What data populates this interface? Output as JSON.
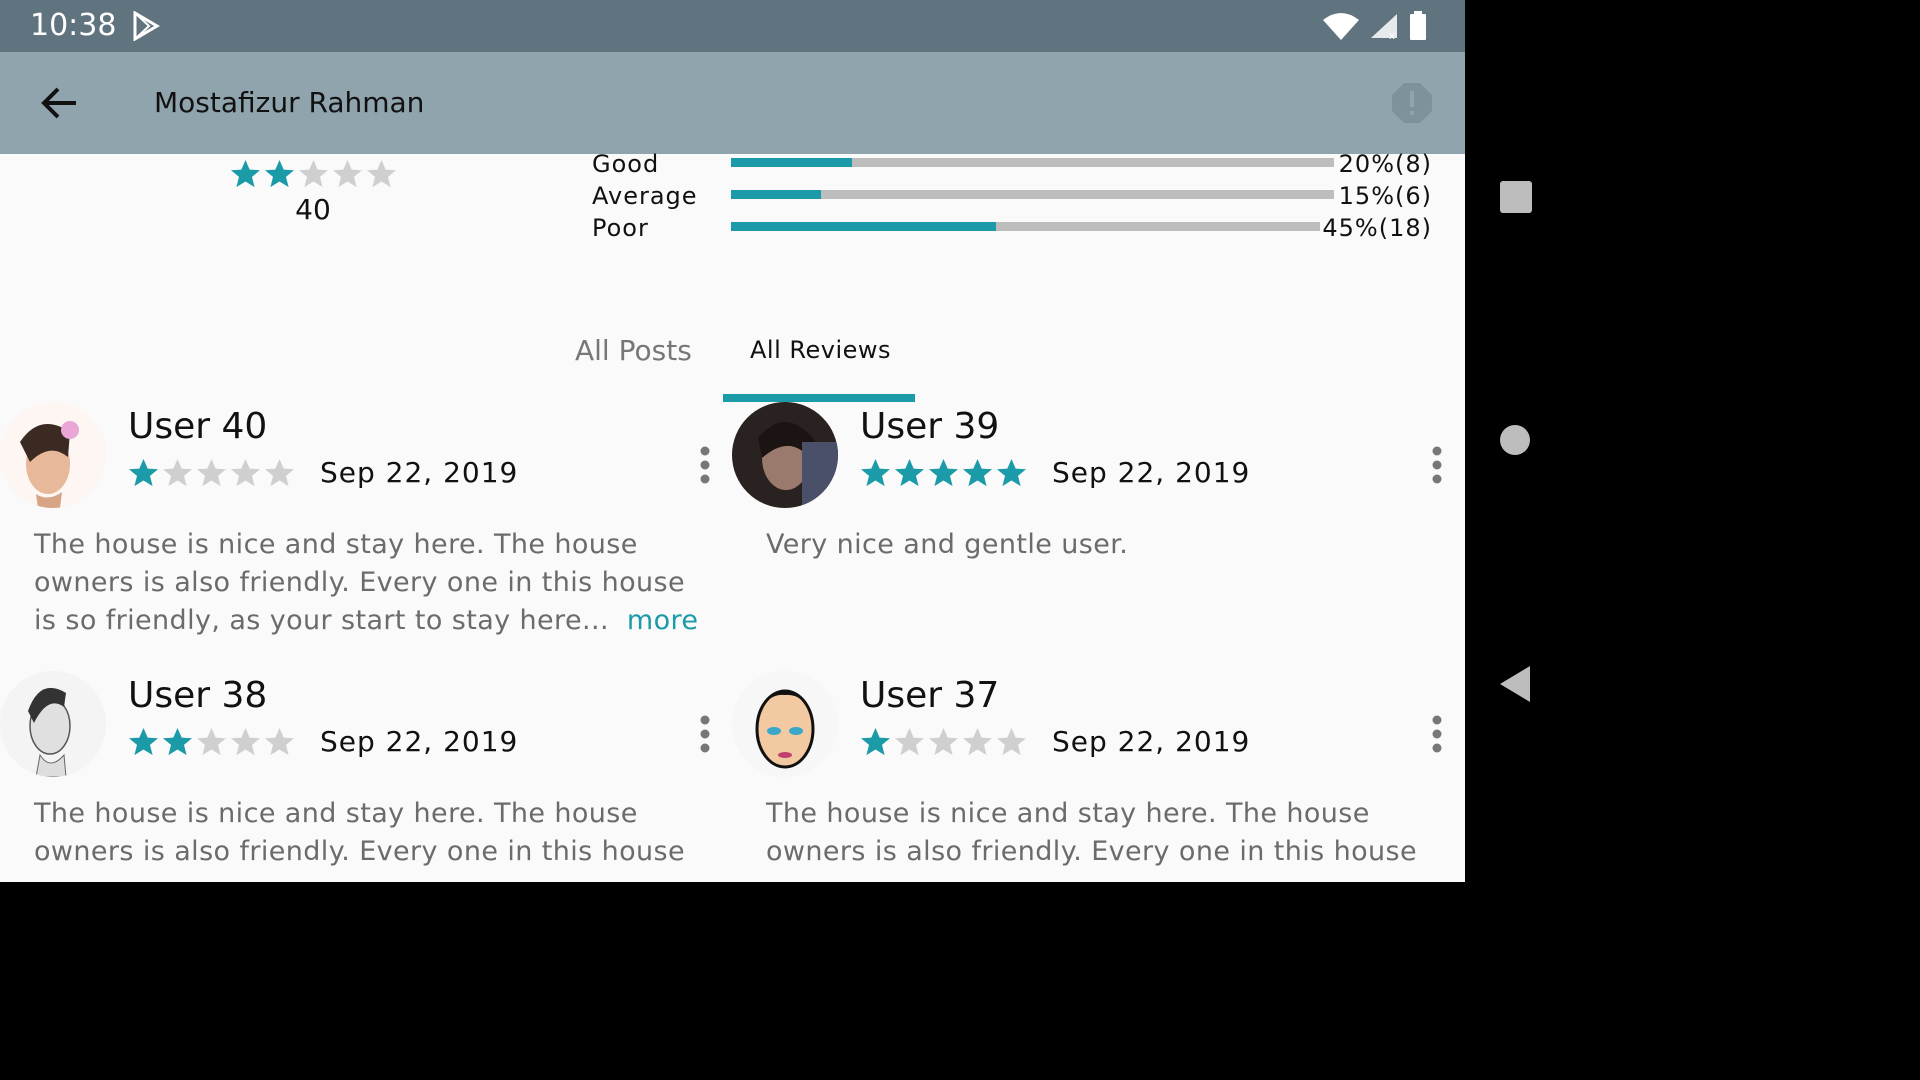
{
  "status": {
    "time": "10:38"
  },
  "appbar": {
    "title": "Mostafizur Rahman"
  },
  "summary": {
    "stars": 2,
    "count": "40"
  },
  "breakdown": [
    {
      "label": "Good",
      "pct_text": "20%(8)",
      "fraction": 0.2
    },
    {
      "label": "Average",
      "pct_text": "15%(6)",
      "fraction": 0.15
    },
    {
      "label": "Poor",
      "pct_text": "45%(18)",
      "fraction": 0.45
    }
  ],
  "tabs": {
    "posts": "All Posts",
    "reviews": "All Reviews"
  },
  "reviews": [
    {
      "user": "User 40",
      "stars": 1,
      "date": "Sep 22, 2019",
      "text": "The house is nice and stay here. The house owners is also friendly. Every one in this house is so friendly, as your start to stay here...",
      "more": "more",
      "avatar": "avatar-woman-flower"
    },
    {
      "user": "User 39",
      "stars": 5,
      "date": "Sep 22, 2019",
      "text": "Very nice and gentle user.",
      "more": "",
      "avatar": "avatar-man-dark"
    },
    {
      "user": "User 38",
      "stars": 2,
      "date": "Sep 22, 2019",
      "text": "The house is nice and stay here. The house owners is also friendly. Every one in this house",
      "more": "",
      "avatar": "avatar-woman-sketch"
    },
    {
      "user": "User 37",
      "stars": 1,
      "date": "Sep 22, 2019",
      "text": "The house is nice and stay here. The house owners is also friendly. Every one in this house",
      "more": "",
      "avatar": "avatar-cartoon-face"
    }
  ],
  "colors": {
    "accent": "#1b9aa8",
    "appbar": "#90a4ae",
    "statusbar": "#607480"
  }
}
